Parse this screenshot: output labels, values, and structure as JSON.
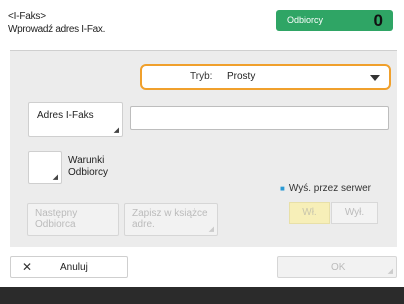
{
  "header": {
    "title": "<I-Faks>",
    "subtitle": "Wprowadź adres I-Fax."
  },
  "recipients": {
    "label": "Odbiorcy",
    "count": "0",
    "color": "#2fa565"
  },
  "mode": {
    "label": "Tryb:",
    "value": "Prosty",
    "highlight_color": "#f0a02c"
  },
  "address": {
    "button_label": "Adres I-Faks",
    "input_value": ""
  },
  "conditions": {
    "label_line1": "Warunki",
    "label_line2": "Odbiorcy"
  },
  "server_send": {
    "label": "Wyś. przez serwer",
    "on_label": "Wł.",
    "off_label": "Wył."
  },
  "buttons": {
    "next_line1": "Następny",
    "next_line2": "Odbiorca",
    "save_line1": "Zapisz w książce",
    "save_line2": "adre.",
    "cancel": "Anuluj",
    "ok": "OK"
  },
  "icons": {
    "cancel": "close-icon",
    "dropdown": "chevron-down-icon",
    "corner": "corner-arrow-icon"
  }
}
